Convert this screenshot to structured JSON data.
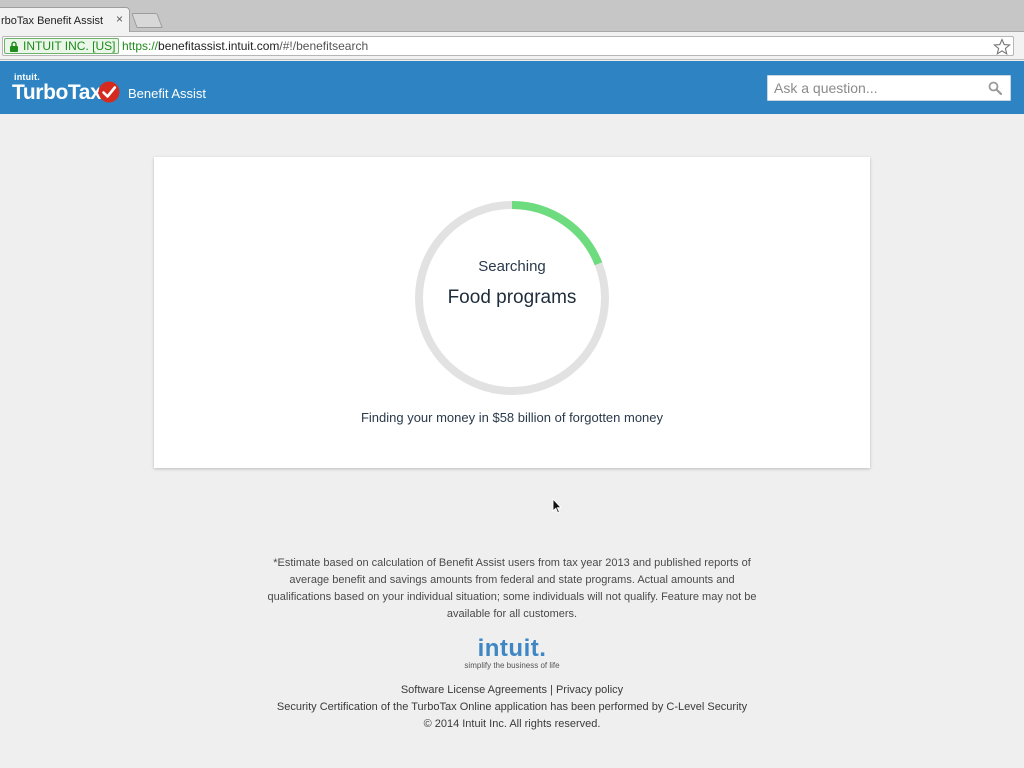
{
  "browser": {
    "tab_title": "rboTax Benefit Assist",
    "tab_close": "×",
    "ev_label": "INTUIT INC. [US]",
    "url_scheme": "https://",
    "url_host": "benefitassist.intuit.com",
    "url_path": "/#!/benefitsearch"
  },
  "header": {
    "brand_small": "intuit.",
    "brand": "TurboTax",
    "product": "Benefit Assist",
    "search_placeholder": "Ask a question..."
  },
  "progress": {
    "status": "Searching",
    "category": "Food programs",
    "caption": "Finding your money in $58 billion of forgotten money",
    "fraction": 0.19,
    "track_color": "#e2e2e2",
    "fill_color": "#6ddc7e"
  },
  "footer": {
    "disclaimer": "*Estimate based on calculation of Benefit Assist users from tax year 2013 and published reports of average benefit and savings amounts from federal and state programs. Actual amounts and qualifications based on your individual situation; some individuals will not qualify. Feature may not be available for all customers.",
    "logo_wordmark": "intuit.",
    "logo_tagline": "simplify the business of life",
    "link_license": "Software License Agreements",
    "link_separator": "|",
    "link_privacy": "Privacy policy",
    "security_text": "Security Certification of the TurboTax Online application has been performed by C-Level Security",
    "copyright": "© 2014 Intuit Inc. All rights reserved."
  },
  "colors": {
    "header_bg": "#2e84c2",
    "page_bg": "#efefef",
    "brand_check": "#d52b1e"
  }
}
